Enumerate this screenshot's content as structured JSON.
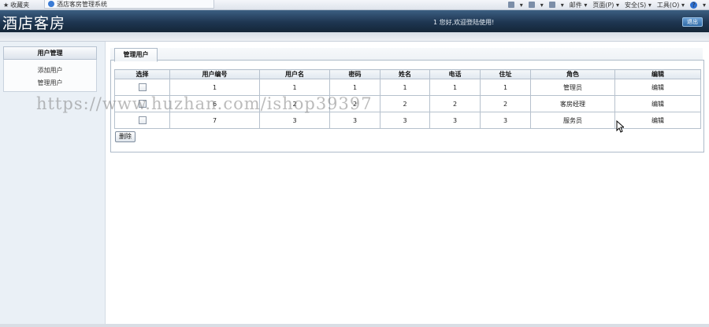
{
  "browser": {
    "favorites": "收藏夹",
    "tab_title": "酒店客房管理系统",
    "toolbar": [
      "▾",
      "▾",
      "▾",
      "邮件 ▾",
      "页面(P) ▾",
      "安全(S) ▾",
      "工具(O) ▾",
      "▾"
    ]
  },
  "header": {
    "title": "酒店客房",
    "welcome": "1 您好,欢迎登陆使用!",
    "logout": "退出"
  },
  "sidebar": {
    "section": "用户管理",
    "items": [
      {
        "label": "添加用户"
      },
      {
        "label": "管理用户"
      }
    ]
  },
  "main": {
    "tab": "管理用户",
    "columns": [
      "选择",
      "用户编号",
      "用户名",
      "密码",
      "姓名",
      "电话",
      "住址",
      "角色",
      "编辑"
    ],
    "rows": [
      {
        "id": "1",
        "username": "1",
        "password": "1",
        "name": "1",
        "phone": "1",
        "address": "1",
        "role": "管理员",
        "edit": "编辑"
      },
      {
        "id": "6",
        "username": "2",
        "password": "2",
        "name": "2",
        "phone": "2",
        "address": "2",
        "role": "客房经理",
        "edit": "编辑"
      },
      {
        "id": "7",
        "username": "3",
        "password": "3",
        "name": "3",
        "phone": "3",
        "address": "3",
        "role": "服务员",
        "edit": "编辑"
      }
    ],
    "delete_label": "删除"
  },
  "watermark": "https://www.huzhan.com/ishop39397",
  "colors": {
    "header_dark": "#1e3651",
    "sidebar_bg": "#eaf0f6",
    "border": "#aebbc9"
  }
}
